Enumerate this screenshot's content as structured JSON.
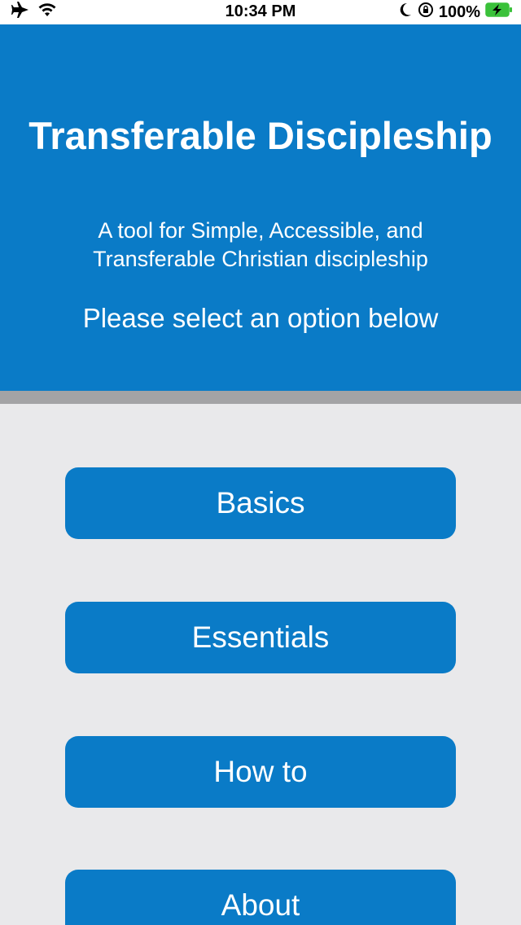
{
  "status_bar": {
    "time": "10:34 PM",
    "battery": "100%",
    "icons": [
      "airplane-icon",
      "wifi-icon",
      "moon-icon",
      "orientation-lock-icon",
      "battery-charging-icon"
    ]
  },
  "header": {
    "title": "Transferable Discipleship",
    "subtitle": "A tool for Simple, Accessible, and Transferable Christian discipleship",
    "prompt": "Please select an option below"
  },
  "menu": {
    "basics_label": "Basics",
    "essentials_label": "Essentials",
    "howto_label": "How to",
    "about_label": "About"
  },
  "colors": {
    "primary": "#0a7bc7",
    "background": "#e9e9eb",
    "divider": "#a3a3a5",
    "battery_green": "#3ac13a"
  }
}
